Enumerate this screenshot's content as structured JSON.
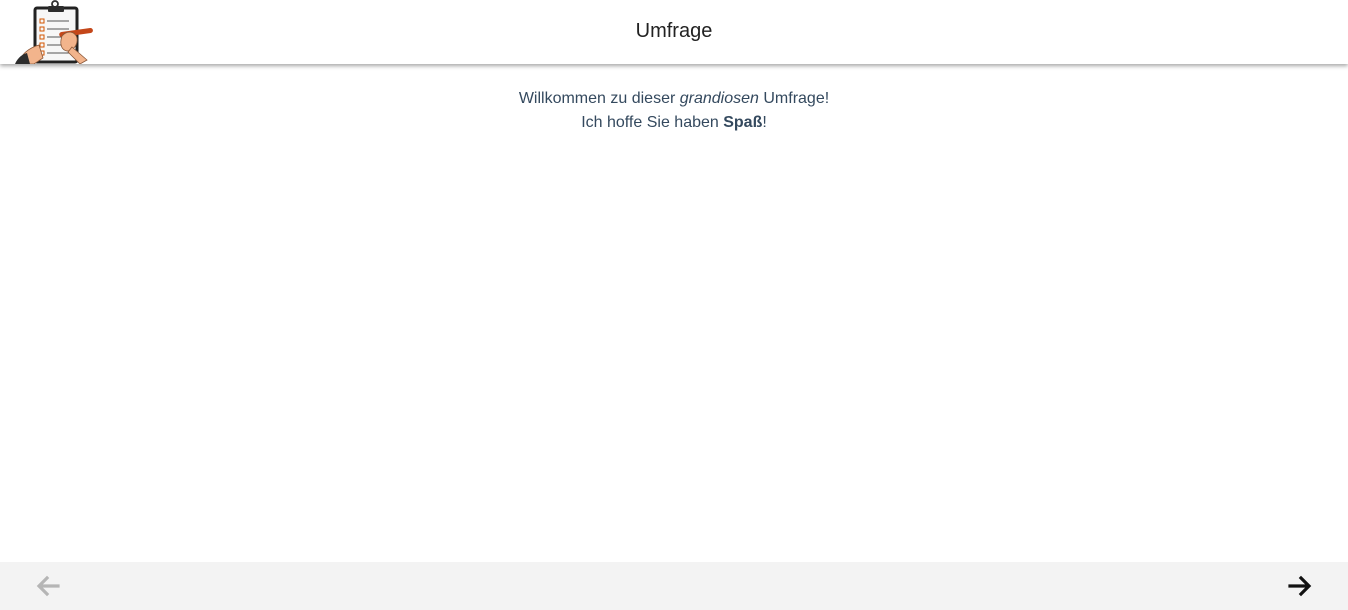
{
  "header": {
    "title": "Umfrage",
    "logo_icon": "clipboard-survey-logo-icon"
  },
  "content": {
    "line1": {
      "before": "Willkommen zu dieser ",
      "emphasis": "grandiosen",
      "after": " Umfrage!"
    },
    "line2": {
      "before": "Ich hoffe Sie haben ",
      "strong": "Spaß",
      "after": "!"
    }
  },
  "navigation": {
    "previous_icon": "arrow-left-icon",
    "next_icon": "arrow-right-icon",
    "previous_enabled": false,
    "next_enabled": true
  },
  "colors": {
    "header_bg": "#ffffff",
    "text": "#34495e",
    "footer_bg": "#f3f3f3",
    "disabled_arrow": "#b5b5b5",
    "enabled_arrow": "#111111"
  }
}
